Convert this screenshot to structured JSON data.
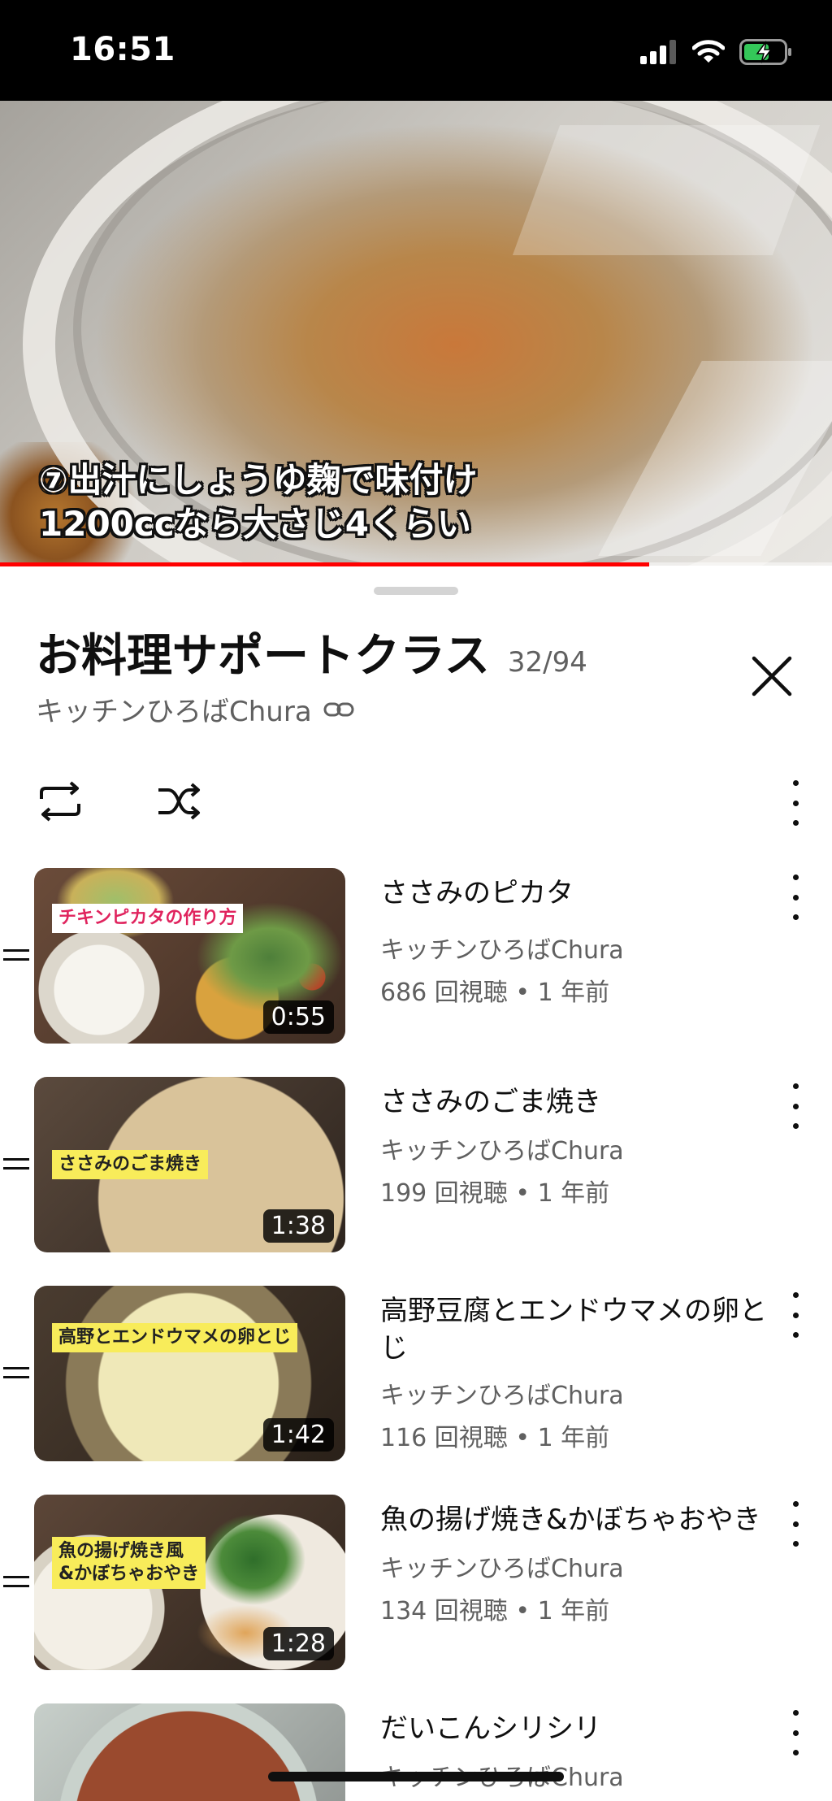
{
  "status_bar": {
    "time": "16:51",
    "battery_color": "#34c759"
  },
  "video": {
    "caption_line1": "⑦出汁にしょうゆ麹で味付け",
    "caption_line2": "1200ccなら大さじ4くらい",
    "progress_fraction": 0.78,
    "progress_color": "#ff0000"
  },
  "playlist": {
    "title": "お料理サポートクラス",
    "position": "32/94",
    "channel": "キッチンひろばChura",
    "controls": {
      "loop_icon": "loop-icon",
      "shuffle_icon": "shuffle-icon",
      "menu_icon": "more-vert-icon"
    }
  },
  "items": [
    {
      "title": "ささみのピカタ",
      "channel": "キッチンひろばChura",
      "meta": "686 回視聴 • 1 年前",
      "duration": "0:55",
      "thumb_label": "チキンピカタの作り方"
    },
    {
      "title": "ささみのごま焼き",
      "channel": "キッチンひろばChura",
      "meta": "199 回視聴 • 1 年前",
      "duration": "1:38",
      "thumb_label": "ささみのごま焼き"
    },
    {
      "title": "高野豆腐とエンドウマメの卵とじ",
      "channel": "キッチンひろばChura",
      "meta": "116 回視聴 • 1 年前",
      "duration": "1:42",
      "thumb_label": "高野とエンドウマメの卵とじ"
    },
    {
      "title": "魚の揚げ焼き&かぼちゃおやき",
      "channel": "キッチンひろばChura",
      "meta": "134 回視聴 • 1 年前",
      "duration": "1:28",
      "thumb_label_line1": "魚の揚げ焼き風",
      "thumb_label_line2": "&かぼちゃおやき"
    },
    {
      "title": "だいこんシリシリ",
      "channel": "キッチンひろばChura"
    }
  ]
}
